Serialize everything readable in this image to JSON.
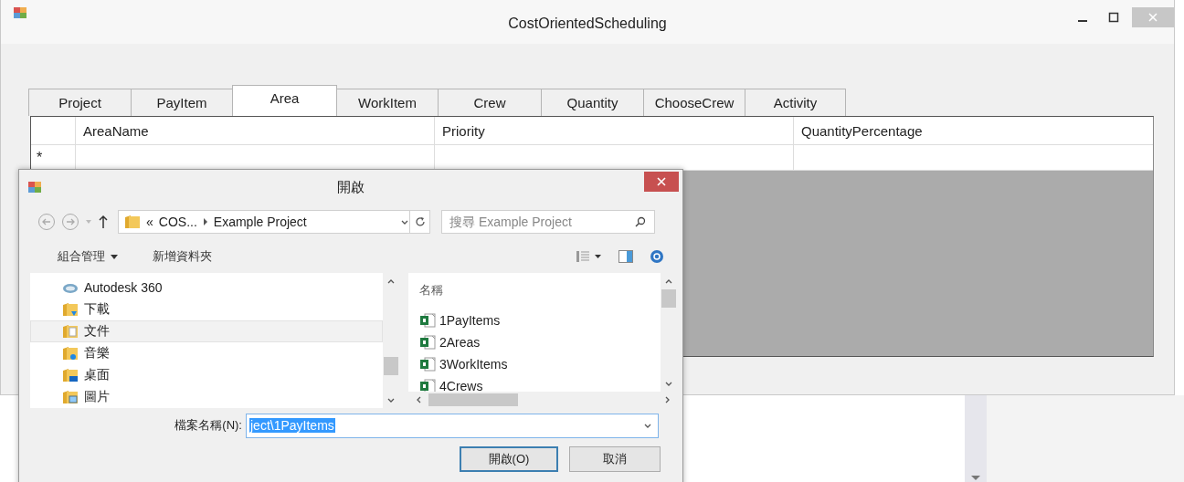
{
  "window": {
    "title": "CostOrientedScheduling"
  },
  "tabs": [
    {
      "label": "Project",
      "selected": false
    },
    {
      "label": "PayItem",
      "selected": false
    },
    {
      "label": "Area",
      "selected": true
    },
    {
      "label": "WorkItem",
      "selected": false
    },
    {
      "label": "Crew",
      "selected": false
    },
    {
      "label": "Quantity",
      "selected": false
    },
    {
      "label": "ChooseCrew",
      "selected": false
    },
    {
      "label": "Activity",
      "selected": false
    }
  ],
  "grid": {
    "columns": [
      "AreaName",
      "Priority",
      "QuantityPercentage"
    ],
    "new_row_marker": "*"
  },
  "dialog": {
    "title": "開啟",
    "address": {
      "overflow": "«",
      "crumbs": [
        "COS...",
        "Example Project"
      ]
    },
    "search": {
      "placeholder": "搜尋 Example Project"
    },
    "toolbar": [
      {
        "label": "組合管理",
        "dropdown": true
      },
      {
        "label": "新增資料夾",
        "dropdown": false
      }
    ],
    "nav_tree": [
      {
        "label": "Autodesk 360",
        "kind": "cloud",
        "selected": false
      },
      {
        "label": "下載",
        "kind": "downloads",
        "selected": false
      },
      {
        "label": "文件",
        "kind": "documents",
        "selected": true
      },
      {
        "label": "音樂",
        "kind": "music",
        "selected": false
      },
      {
        "label": "桌面",
        "kind": "desktop",
        "selected": false
      },
      {
        "label": "圖片",
        "kind": "pictures",
        "selected": false
      }
    ],
    "file_list": {
      "header": "名稱",
      "files": [
        "1PayItems",
        "2Areas",
        "3WorkItems",
        "4Crews"
      ]
    },
    "filename": {
      "label": "檔案名稱(N):",
      "value": "ject\\1PayItems",
      "selected": true
    },
    "buttons": [
      {
        "label": "開啟(O)",
        "default": true
      },
      {
        "label": "取消",
        "default": false
      }
    ]
  }
}
